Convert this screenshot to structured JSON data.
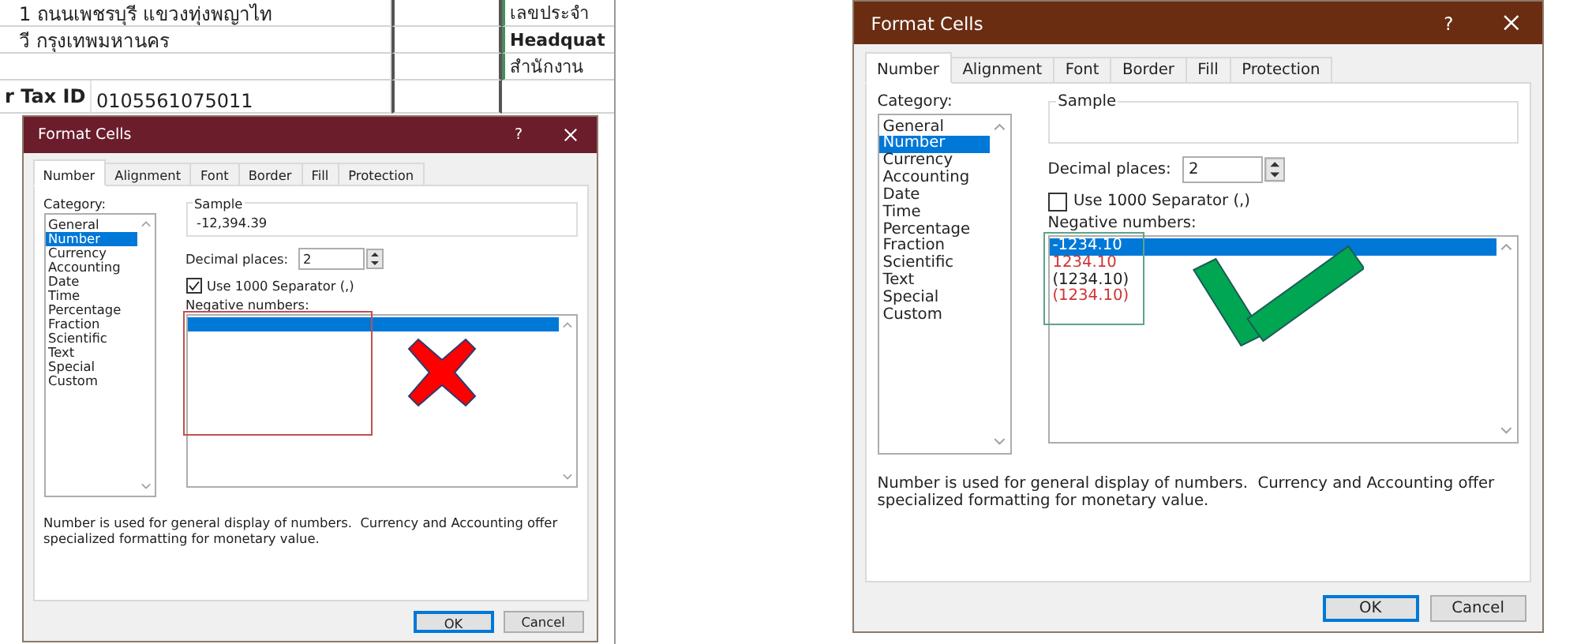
{
  "spreadsheet": {
    "rows": [
      {
        "address": "1 ถนนเพชรบุรี แขวงทุ่งพญาไท",
        "note": "เลขประจำ",
        "note_bold": false
      },
      {
        "address": "วี กรุงเทพมหานคร",
        "note": "Headquat",
        "note_bold": true
      },
      {
        "note": "สำนักงาน",
        "note_bold": false
      }
    ],
    "tax_label": "r Tax ID",
    "tax_value": "0105561075011"
  },
  "dialogs": [
    {
      "title": "Format Cells",
      "color": "#6b1d2c",
      "help": "?",
      "tabs": [
        {
          "label": "Number",
          "selected": true
        },
        {
          "label": "Alignment",
          "selected": false
        },
        {
          "label": "Font",
          "selected": false
        },
        {
          "label": "Border",
          "selected": false
        },
        {
          "label": "Fill",
          "selected": false
        },
        {
          "label": "Protection",
          "selected": false
        }
      ],
      "category_label": "Category:",
      "categories": [
        {
          "label": "General",
          "selected": false
        },
        {
          "label": "Number",
          "selected": true
        },
        {
          "label": "Currency",
          "selected": false
        },
        {
          "label": "Accounting",
          "selected": false
        },
        {
          "label": "Date",
          "selected": false
        },
        {
          "label": "Time",
          "selected": false
        },
        {
          "label": "Percentage",
          "selected": false
        },
        {
          "label": "Fraction",
          "selected": false
        },
        {
          "label": "Scientific",
          "selected": false
        },
        {
          "label": "Text",
          "selected": false
        },
        {
          "label": "Special",
          "selected": false
        },
        {
          "label": "Custom",
          "selected": false
        }
      ],
      "sample": {
        "label": "Sample",
        "value": "-12,394.39"
      },
      "decimal": {
        "label": "Decimal places:",
        "value": "2"
      },
      "separator": {
        "label": "Use 1000 Separator (,)",
        "checked": true
      },
      "negative": {
        "label": "Negative numbers:",
        "items": [
          {
            "selected": true
          }
        ]
      },
      "description": "Number is used for general display of numbers.  Currency and Accounting offer specialized formatting for monetary value.",
      "buttons": [
        {
          "label": "OK",
          "default": true
        },
        {
          "label": "Cancel",
          "default": false
        }
      ],
      "annotation": {
        "kind": "cross"
      }
    },
    {
      "title": "Format Cells",
      "color": "#6a2d12",
      "help": "?",
      "tabs": [
        {
          "label": "Number",
          "selected": true
        },
        {
          "label": "Alignment",
          "selected": false
        },
        {
          "label": "Font",
          "selected": false
        },
        {
          "label": "Border",
          "selected": false
        },
        {
          "label": "Fill",
          "selected": false
        },
        {
          "label": "Protection",
          "selected": false
        }
      ],
      "category_label": "Category:",
      "categories": [
        {
          "label": "General",
          "selected": false
        },
        {
          "label": "Number",
          "selected": true
        },
        {
          "label": "Currency",
          "selected": false
        },
        {
          "label": "Accounting",
          "selected": false
        },
        {
          "label": "Date",
          "selected": false
        },
        {
          "label": "Time",
          "selected": false
        },
        {
          "label": "Percentage",
          "selected": false
        },
        {
          "label": "Fraction",
          "selected": false
        },
        {
          "label": "Scientific",
          "selected": false
        },
        {
          "label": "Text",
          "selected": false
        },
        {
          "label": "Special",
          "selected": false
        },
        {
          "label": "Custom",
          "selected": false
        }
      ],
      "sample": {
        "label": "Sample"
      },
      "decimal": {
        "label": "Decimal places:",
        "value": "2"
      },
      "separator": {
        "label": "Use 1000 Separator (,)",
        "checked": false
      },
      "negative": {
        "label": "Negative numbers:",
        "items": [
          {
            "text": "-1234.10",
            "selected": true
          },
          {
            "text": "1234.10",
            "selected": false,
            "color": "#d13438"
          },
          {
            "text": "(1234.10)",
            "selected": false
          },
          {
            "text": "(1234.10)",
            "selected": false,
            "color": "#d13438"
          }
        ]
      },
      "description": "Number is used for general display of numbers.  Currency and Accounting offer specialized formatting for monetary value.",
      "buttons": [
        {
          "label": "OK",
          "default": true
        },
        {
          "label": "Cancel",
          "default": false
        }
      ],
      "annotation": {
        "kind": "check"
      }
    }
  ]
}
